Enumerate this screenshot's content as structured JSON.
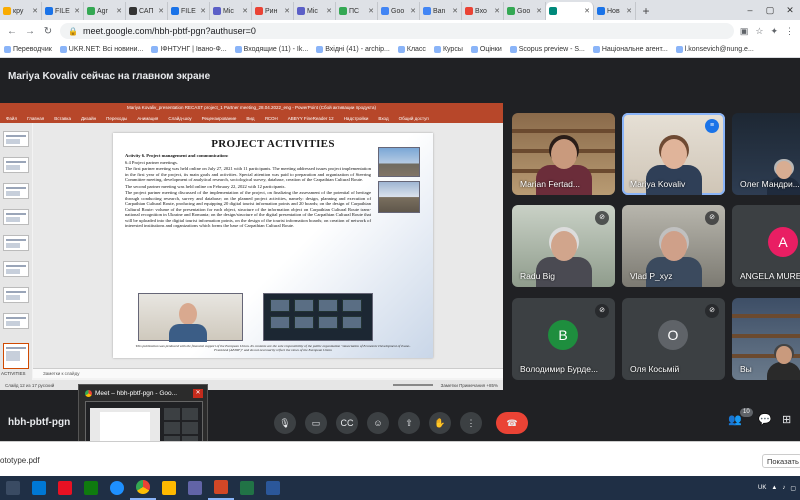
{
  "browser": {
    "tabs": [
      {
        "label": "кру",
        "color": "#f9ab00"
      },
      {
        "label": "FILE",
        "color": "#1a73e8"
      },
      {
        "label": "Agr",
        "color": "#34a853"
      },
      {
        "label": "САП",
        "color": "#333333"
      },
      {
        "label": "FILE",
        "color": "#1a73e8"
      },
      {
        "label": "Mic",
        "color": "#5b5fc7"
      },
      {
        "label": "Рин",
        "color": "#ea4335"
      },
      {
        "label": "Mic",
        "color": "#5b5fc7"
      },
      {
        "label": "ПС",
        "color": "#34a853"
      },
      {
        "label": "Goo",
        "color": "#4285f4"
      },
      {
        "label": "Ban",
        "color": "#4285f4"
      },
      {
        "label": "Вхо",
        "color": "#ea4335"
      },
      {
        "label": "Goo",
        "color": "#34a853"
      },
      {
        "label": "",
        "color": "#00897b"
      },
      {
        "label": "Нов",
        "color": "#1a73e8"
      }
    ],
    "url": "meet.google.com/hbh-pbtf-pgn?authuser=0",
    "bookmarks": [
      {
        "label": "Переводчик"
      },
      {
        "label": "UKR.NET: Всі новини..."
      },
      {
        "label": "ІФНТУНГ | Івано-Ф..."
      },
      {
        "label": "Входящие (11) - Ik..."
      },
      {
        "label": "Вхідні (41) - archip..."
      },
      {
        "label": "Класс"
      },
      {
        "label": "Курсы"
      },
      {
        "label": "Оцінки"
      },
      {
        "label": "Scopus preview - S..."
      },
      {
        "label": "Національне агент..."
      },
      {
        "label": "l.konsevich@nung.e..."
      }
    ]
  },
  "meet": {
    "presenting_banner": "Mariya Kovaliv сейчас на главном экране",
    "meeting_code": "hbh-pbtf-pgn",
    "participant_count": "10",
    "participants": [
      {
        "name": "Marian Fertad...",
        "kind": "video",
        "muted": false,
        "speaking": false
      },
      {
        "name": "Mariya Kovaliv",
        "kind": "video",
        "muted": false,
        "speaking": true
      },
      {
        "name": "Олег Мандри...",
        "kind": "video",
        "muted": false,
        "speaking": false
      },
      {
        "name": "Radu Big",
        "kind": "video",
        "muted": true,
        "speaking": false
      },
      {
        "name": "Vlad P_xyz",
        "kind": "video",
        "muted": true,
        "speaking": false
      },
      {
        "name": "ANGELA MURE...",
        "kind": "avatar",
        "letter": "A",
        "color": "#e91e63",
        "muted": true,
        "speaking": false
      },
      {
        "name": "Володимир Бурде...",
        "kind": "avatar",
        "letter": "В",
        "color": "#1e8e3e",
        "muted": true,
        "speaking": false
      },
      {
        "name": "Оля Косьмій",
        "kind": "avatar",
        "letter": "О",
        "color": "#5f6368",
        "muted": true,
        "speaking": false
      },
      {
        "name": "Вы",
        "kind": "video",
        "muted": true,
        "speaking": false
      }
    ]
  },
  "ppt": {
    "window_title": "Mariya Kovaliv_presentation RECAST project_1 Partner meeting_28.04.2022_eng - PowerPoint (Сбой активации продукта)",
    "ribbon": [
      "Файл",
      "Главная",
      "Вставка",
      "Дизайн",
      "Переходы",
      "Анимация",
      "Слайд-шоу",
      "Рецензирование",
      "Вид",
      "ЯСОН",
      "ABBYY FineReader 12",
      "Надстройки",
      "Вход",
      "Общий доступ"
    ],
    "thumb_caption": "ACTIVITIES",
    "notes_placeholder": "Заметки к слайду",
    "status_left": "Слайд 12 из 17   русский",
    "status_right": "Заметки   Примечания   +85%",
    "slide": {
      "title": "PROJECT ACTIVITIES",
      "heading": "Activity 6. Project management and communication:",
      "subheading": "6.4 Project partner meetings.",
      "p1": "The first partner meeting was held online on July 27, 2021 with 11 participants. The meeting addressed issues project implementation in the first year of the project, its main goals and activities. Special attention was paid to preparation and organization of Steering Committee meeting, development of analytical research, sociological survey, database, creation of the Carpathian Cultural Route.",
      "p2": "The second partner meeting was held online on February 22, 2022 with 12 participants.",
      "p3": "The project partner meeting discussed of the implementation of the project, on finalizing the assessment of the potential of heritage through conducting research, survey and database; on the planned project activities, namely: design, planning and execution of Carpathian Cultural Route, producing and equipping 20 digital tourist information points and 20 boards; on the design of Carpathian Cultural Route: volume of the presentation for each object, structure of the information object on Carpathian Cultural Route trans-national recognition in Ukraine and Romania; on the design/structure of the digital presentation of the Carpathian Cultural Route that will be uploaded into the digital tourist information points, on the design of the tourist information boards; on creation of network of interested institutions and organizations which forms the base of Carpathian Cultural Route.",
      "footer": "This publication was produced with the financial support of the European Union. Its contents are the sole responsibility of the public organization \"Association of Economic Development of Ivano-Frankivsk (AEDIF)\" and do not necessarily reflect the views of the European Union"
    }
  },
  "preview": {
    "title": "Meet – hbh-pbtf-pgn - Goo..."
  },
  "downloads": {
    "file": "ototype.pdf",
    "show_all": "Показать"
  },
  "tray": {
    "lang": "UK"
  }
}
